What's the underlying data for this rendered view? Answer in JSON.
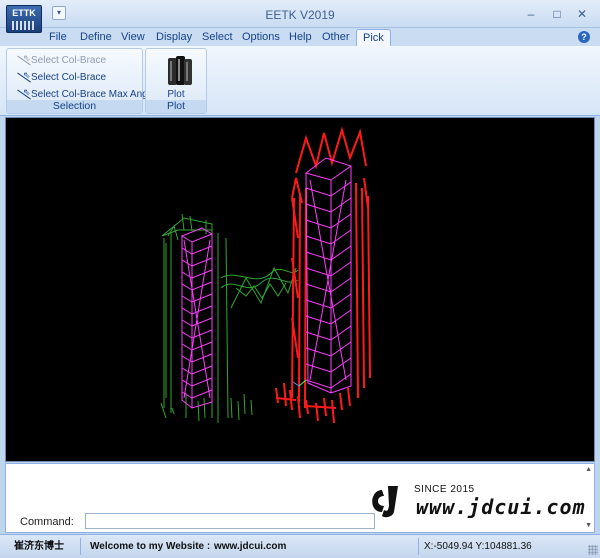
{
  "app": {
    "logo_text": "ETTK",
    "title": "EETK V2019",
    "qat_icon": "customize-qat-chevron-icon",
    "window_buttons": {
      "minimize": "–",
      "maximize": "□",
      "close": "✕"
    }
  },
  "tabs": [
    {
      "label": "File"
    },
    {
      "label": "Define"
    },
    {
      "label": "View"
    },
    {
      "label": "Display"
    },
    {
      "label": "Select"
    },
    {
      "label": "Options"
    },
    {
      "label": "Help"
    },
    {
      "label": "Other"
    },
    {
      "label": "Pick"
    }
  ],
  "active_tab": "Pick",
  "help_glyph": "?",
  "ribbon": {
    "selection": {
      "items": [
        {
          "label": "Select Col-Brace",
          "enabled": false,
          "icon": "brace-select-icon"
        },
        {
          "label": "Select Col-Brace",
          "enabled": true,
          "icon": "brace-select-icon"
        },
        {
          "label": "Select Col-Brace Max Angle",
          "enabled": true,
          "icon": "brace-angle-icon"
        }
      ],
      "group_label": "Selection"
    },
    "plot": {
      "label": "Plot",
      "icon": "plot-icon",
      "group_label": "Plot"
    }
  },
  "colors": {
    "green_model": "#2fa82f",
    "red_model": "#ff1a1a",
    "magenta": "#ff3cff",
    "background": "#000000"
  },
  "command": {
    "label": "Command:",
    "value": ""
  },
  "watermark": {
    "since": "SINCE 2015",
    "url": "www.jdcui.com",
    "logo_text": "CJ"
  },
  "status": {
    "author": "崔济东博士",
    "welcome": "Welcome to my Website :",
    "website": "www.jdcui.com",
    "coords": "X:-5049.94 Y:104881.36"
  }
}
